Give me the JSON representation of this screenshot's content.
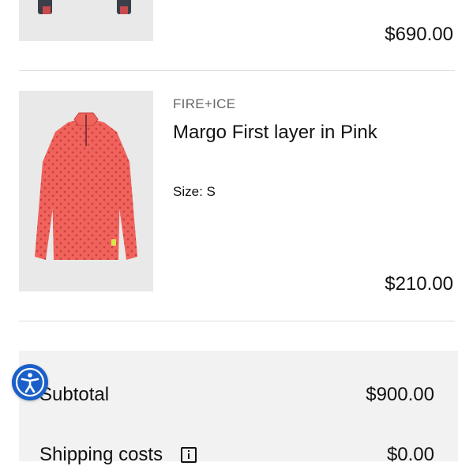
{
  "item_prev": {
    "price": "$690.00"
  },
  "item_current": {
    "brand": "FIRE+ICE",
    "name": "Margo First layer in Pink",
    "size_label": "Size: S",
    "price": "$210.00"
  },
  "summary": {
    "subtotal_label": "Subtotal",
    "subtotal_value": "$900.00",
    "shipping_label": "Shipping costs",
    "shipping_value": "$0.00"
  },
  "colors": {
    "accent_blue": "#1a5fc9",
    "product_pink": "#f0635d",
    "panel_gray": "#f2f2f2"
  },
  "icons": [
    "accessibility-icon",
    "info-icon"
  ]
}
